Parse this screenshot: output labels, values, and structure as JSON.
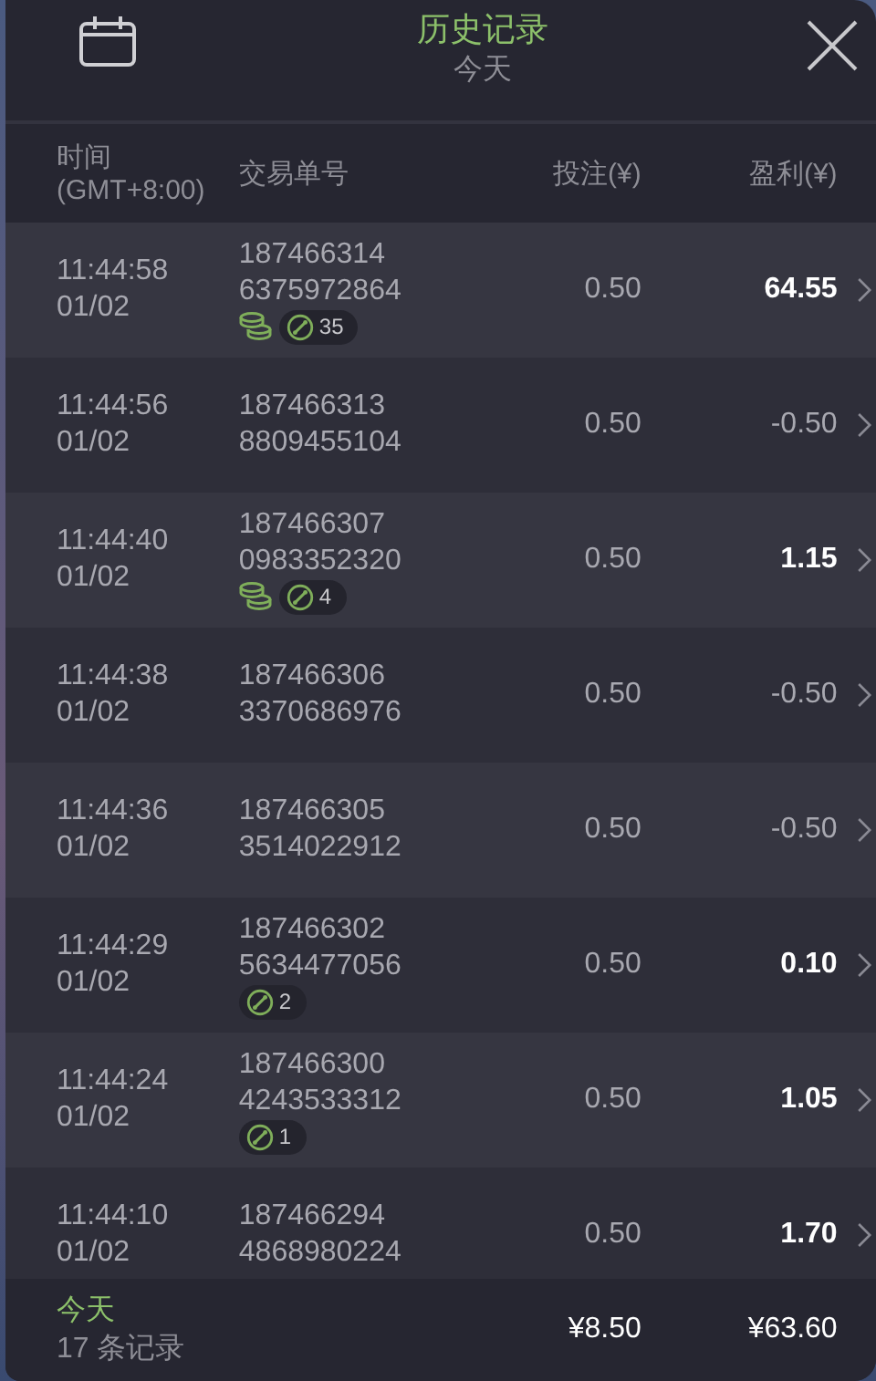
{
  "header": {
    "title": "历史记录",
    "subtitle": "今天"
  },
  "columns": {
    "time": "时间",
    "timezone": "(GMT+8:00)",
    "order": "交易单号",
    "bet": "投注(¥)",
    "profit": "盈利(¥)"
  },
  "rows": [
    {
      "time": "11:44:58",
      "date": "01/02",
      "order_1": "187466314",
      "order_2": "6375972864",
      "bet": "0.50",
      "profit": "64.55",
      "win": true,
      "coins": true,
      "count": "35"
    },
    {
      "time": "11:44:56",
      "date": "01/02",
      "order_1": "187466313",
      "order_2": "8809455104",
      "bet": "0.50",
      "profit": "-0.50",
      "win": false,
      "coins": false
    },
    {
      "time": "11:44:40",
      "date": "01/02",
      "order_1": "187466307",
      "order_2": "0983352320",
      "bet": "0.50",
      "profit": "1.15",
      "win": true,
      "coins": true,
      "count": "4"
    },
    {
      "time": "11:44:38",
      "date": "01/02",
      "order_1": "187466306",
      "order_2": "3370686976",
      "bet": "0.50",
      "profit": "-0.50",
      "win": false,
      "coins": false
    },
    {
      "time": "11:44:36",
      "date": "01/02",
      "order_1": "187466305",
      "order_2": "3514022912",
      "bet": "0.50",
      "profit": "-0.50",
      "win": false,
      "coins": false
    },
    {
      "time": "11:44:29",
      "date": "01/02",
      "order_1": "187466302",
      "order_2": "5634477056",
      "bet": "0.50",
      "profit": "0.10",
      "win": true,
      "coins": false,
      "count": "2"
    },
    {
      "time": "11:44:24",
      "date": "01/02",
      "order_1": "187466300",
      "order_2": "4243533312",
      "bet": "0.50",
      "profit": "1.05",
      "win": true,
      "coins": false,
      "count": "1"
    },
    {
      "time": "11:44:10",
      "date": "01/02",
      "order_1": "187466294",
      "order_2": "4868980224",
      "bet": "0.50",
      "profit": "1.70",
      "win": true,
      "coins": false
    }
  ],
  "footer": {
    "period": "今天",
    "records": "17 条记录",
    "total_bet": "¥8.50",
    "total_profit": "¥63.60"
  }
}
